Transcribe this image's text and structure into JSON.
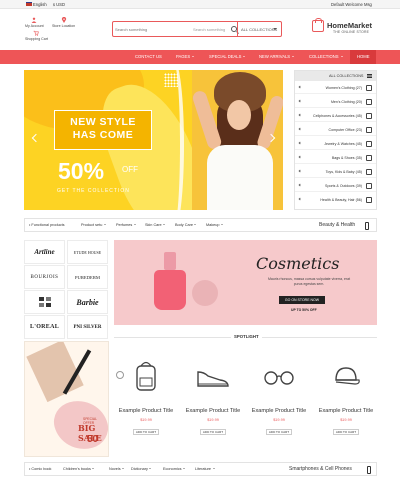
{
  "topbar": {
    "language": "English",
    "currency": "USD",
    "welcome": "Default Welcome Msg"
  },
  "header": {
    "my_account": "My Account",
    "store_location": "Store Location",
    "shopping_cart": "Shopping Cart",
    "search_placeholder": "Search something",
    "search_category": "ALL COLLECTIONS",
    "logo_name": "HomeMarket",
    "logo_tagline": "THE ONLINE STORE"
  },
  "nav": {
    "items": [
      "CONTACT US",
      "PAGES",
      "SPECIAL DEALS",
      "NEW ARRIVALS",
      "COLLECTIONS",
      "HOME"
    ],
    "accent": "#ee5557"
  },
  "banner": {
    "headline_1": "NEW STYLE",
    "headline_2": "HAS COME",
    "percent": "50%",
    "off": "OFF",
    "cta": "GET THE COLLECTION"
  },
  "categories": {
    "header": "ALL COLLECTIONS",
    "items": [
      "Women's Clothing (27)",
      "Men's Clothing (20)",
      "Cellphones & Accessories (45)",
      "Computer Office (23)",
      "Jewelry & Watches (45)",
      "Bags & Shoes (35)",
      "Toys, Kids & Baby (45)",
      "Sports & Outdoors (39)",
      "Health & Beauty, Hair (56)"
    ]
  },
  "strip1": {
    "tabs": [
      "Functional products",
      "Product setu",
      "Perfumes",
      "Skin Care",
      "Body Care",
      "Makeup"
    ],
    "title": "Beauty & Health"
  },
  "brands": [
    "Artline",
    "ETUDE HOUSE",
    "BOURJOIS",
    "PUREDERM",
    "",
    "Barbie",
    "L'OREAL",
    "PNI SILVER"
  ],
  "cosmetics": {
    "title": "Cosmetics",
    "subtitle": "Mauris rhoncus, massa cursus vulputate viverra, erat purus egestas sem.",
    "button": "GO ON STORE NOW",
    "discount": "UP TO 50% OFF"
  },
  "promo": {
    "special": "SPECIAL OFFER",
    "big_sale": "BIG SALE",
    "percent": "50"
  },
  "spotlight": {
    "title": "SPOTLIGHT",
    "products": [
      {
        "name": "Example Product Title",
        "price": "$19.99",
        "button": "ADD TO CART"
      },
      {
        "name": "Example Product Title",
        "price": "$19.99",
        "button": "ADD TO CART"
      },
      {
        "name": "Example Product Title",
        "price": "$19.99",
        "button": "ADD TO CART"
      },
      {
        "name": "Example Product Title",
        "price": "$19.99",
        "button": "ADD TO CART"
      }
    ]
  },
  "strip2": {
    "tabs": [
      "Comic book",
      "Children's books",
      "Novels",
      "Dictionary",
      "Economics",
      "Literature"
    ],
    "title": "Smartphones & Cell Phones"
  }
}
